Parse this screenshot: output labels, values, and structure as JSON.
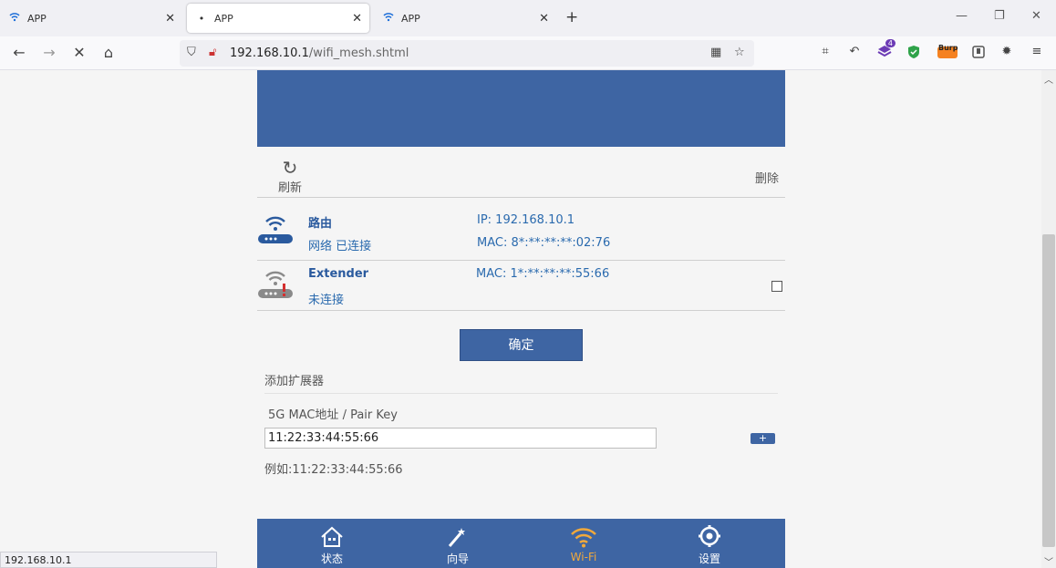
{
  "browser": {
    "tabs": [
      {
        "title": "APP",
        "icon": "wifi-icon",
        "active": false
      },
      {
        "title": "APP",
        "icon": "loading-dot-icon",
        "active": true
      },
      {
        "title": "APP",
        "icon": "wifi-icon",
        "active": false
      }
    ],
    "url_host": "192.168.10.1",
    "url_path": "/wifi_mesh.shtml",
    "status_text": "192.168.10.1",
    "extension_badge": "4",
    "burp_label": "Burp"
  },
  "page": {
    "refresh_label": "刷新",
    "delete_label": "删除",
    "devices": [
      {
        "name": "路由",
        "status": "网络 已连接",
        "ip": "IP: 192.168.10.1",
        "mac": "MAC: 8*:**:**:**:02:76"
      },
      {
        "name": "Extender",
        "status": "未连接",
        "mac": "MAC: 1*:**:**:**:55:66"
      }
    ],
    "confirm_label": "确定",
    "add_extender_title": "添加扩展器",
    "field_label": "5G MAC地址 / Pair Key",
    "mac_input_value": "11:22:33:44:55:66",
    "plus_label": "+",
    "example_text": "例如:11:22:33:44:55:66"
  },
  "bottom_nav": [
    {
      "label": "状态",
      "icon": "home-icon",
      "active": false
    },
    {
      "label": "向导",
      "icon": "wand-icon",
      "active": false
    },
    {
      "label": "Wi-Fi",
      "icon": "wifi-icon",
      "active": true
    },
    {
      "label": "设置",
      "icon": "gear-icon",
      "active": false
    }
  ],
  "colors": {
    "brand": "#3e65a3",
    "active_nav": "#f2a93b",
    "link_blue": "#2a6aae"
  }
}
